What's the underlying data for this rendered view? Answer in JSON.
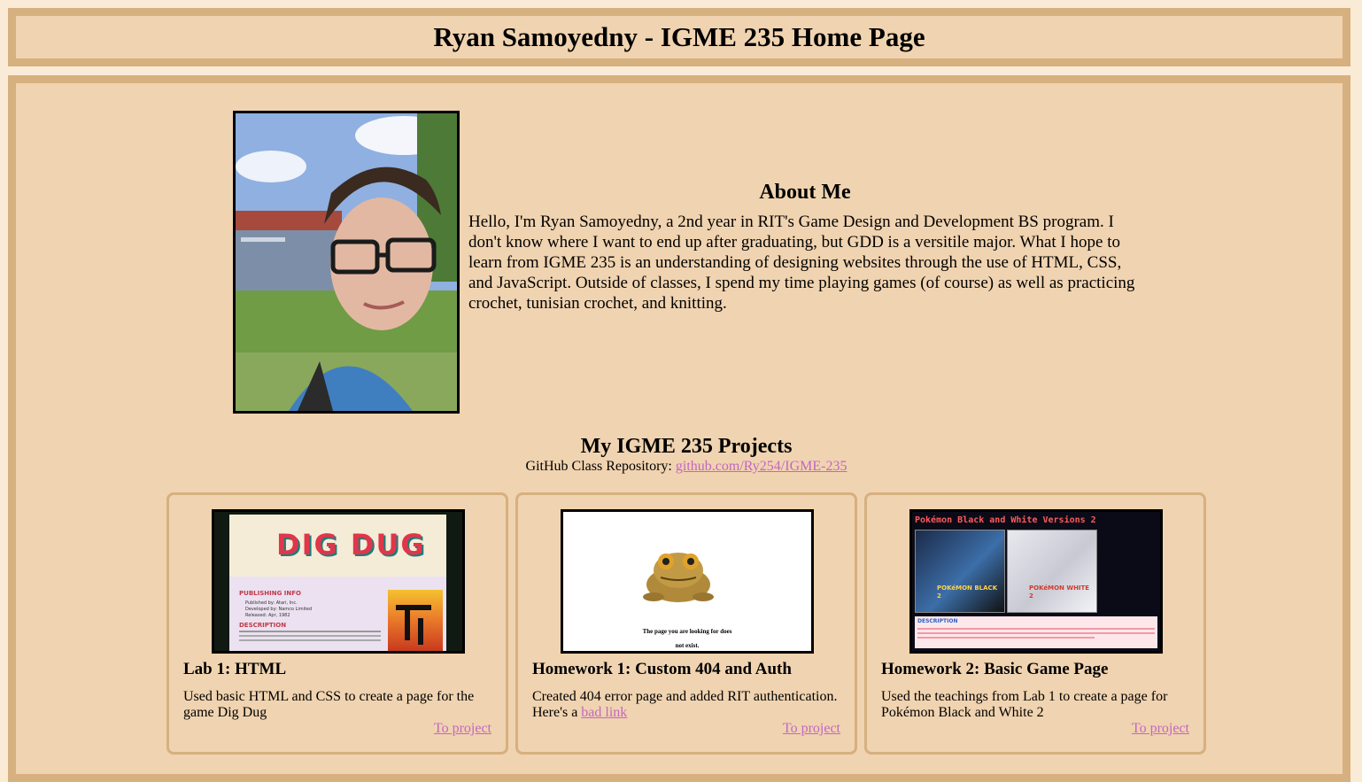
{
  "header": {
    "title": "Ryan Samoyedny - IGME 235 Home Page"
  },
  "about": {
    "heading": "About Me",
    "text": "Hello, I'm Ryan Samoyedny, a 2nd year in RIT's Game Design and Development BS program. I don't know where I want to end up after graduating, but GDD is a versitile major. What I hope to learn from IGME 235 is an understanding of designing websites through the use of HTML, CSS, and JavaScript. Outside of classes, I spend my time playing games (of course) as well as practicing crochet, tunisian crochet, and knitting."
  },
  "projects": {
    "heading": "My IGME 235 Projects",
    "repo_label": "GitHub Class Repository: ",
    "repo_link": "github.com/Ry254/IGME-235",
    "cards": [
      {
        "title": "Lab 1: HTML",
        "desc": "Used basic HTML and CSS to create a page for the game Dig Dug",
        "link": "To project",
        "thumb": {
          "logo": "DIG DUG",
          "section1": "PUBLISHING INFO",
          "bullet1": "Published by: Atari, Inc.",
          "bullet2": "Developed by: Namco Limited",
          "bullet3": "Released: Apr, 1982",
          "section2": "DESCRIPTION"
        }
      },
      {
        "title": "Homework 1: Custom 404 and Auth",
        "desc_before": "Created 404 error page and added RIT authentication. Here's a ",
        "desc_link": "bad link",
        "link": "To project",
        "thumb": {
          "msg1": "The page you are looking for does",
          "msg2": "not exist."
        }
      },
      {
        "title": "Homework 2: Basic Game Page",
        "desc": "Used the teachings from Lab 1 to create a page for Pokémon Black and White 2",
        "link": "To project",
        "thumb": {
          "title": "Pokémon Black and White Versions 2",
          "box1": "POKéMON BLACK 2",
          "box2": "POKéMON WHITE 2",
          "section": "DESCRIPTION"
        }
      }
    ]
  }
}
